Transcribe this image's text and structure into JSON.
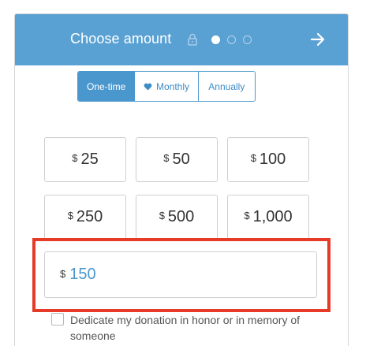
{
  "header": {
    "title": "Choose amount",
    "lock_icon": "lock-icon",
    "next_icon": "arrow-right-icon",
    "steps_total": 3,
    "current_step": 1
  },
  "frequency": {
    "options": [
      {
        "label": "One-time",
        "selected": true
      },
      {
        "label": "Monthly",
        "icon": "heart-icon",
        "selected": false
      },
      {
        "label": "Annually",
        "selected": false
      }
    ]
  },
  "amounts": {
    "currency": "$",
    "options": [
      "25",
      "50",
      "100",
      "250",
      "500",
      "1,000"
    ]
  },
  "custom_amount": {
    "currency": "$",
    "value": "150"
  },
  "dedication": {
    "checked": false,
    "label": "Dedicate my donation in honor or in memory of someone"
  },
  "colors": {
    "header_bg": "#5aa1d3",
    "accent": "#4a97cd",
    "highlight": "#e53b28"
  }
}
